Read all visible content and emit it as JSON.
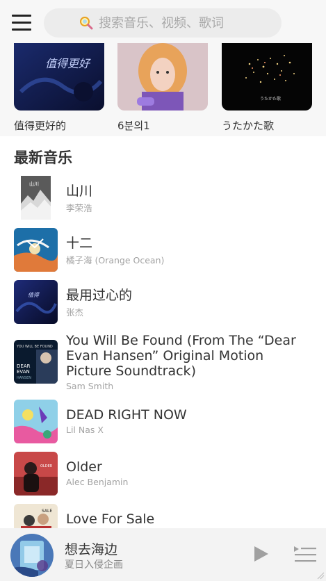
{
  "header": {
    "search_placeholder": "搜索音乐、视频、歌词"
  },
  "albums": [
    {
      "title": "值得更好的"
    },
    {
      "title": "6분의1"
    },
    {
      "title": "うたかた歌"
    }
  ],
  "section": {
    "title": "最新音乐"
  },
  "songs": [
    {
      "title": "山川",
      "artist": "李荣浩"
    },
    {
      "title": "十二",
      "artist": "橘子海 (Orange Ocean)"
    },
    {
      "title": "最用过心的",
      "artist": "张杰"
    },
    {
      "title": "You Will Be Found (From The “Dear Evan Hansen” Original Motion Picture Soundtrack)",
      "artist": "Sam Smith"
    },
    {
      "title": "DEAD RIGHT NOW",
      "artist": "Lil Nas X"
    },
    {
      "title": "Older",
      "artist": "Alec Benjamin"
    },
    {
      "title": "Love For Sale",
      "artist": ""
    }
  ],
  "player": {
    "title": "想去海边",
    "artist": "夏日入侵企画"
  },
  "colors": {
    "header_bg": "#f7f7f7",
    "player_bg": "#f3f3f3",
    "text_primary": "#333333",
    "text_secondary": "#a3a3a3"
  },
  "icons": [
    "menu-icon",
    "search-icon",
    "play-icon",
    "playlist-icon",
    "resize-grip-icon"
  ]
}
